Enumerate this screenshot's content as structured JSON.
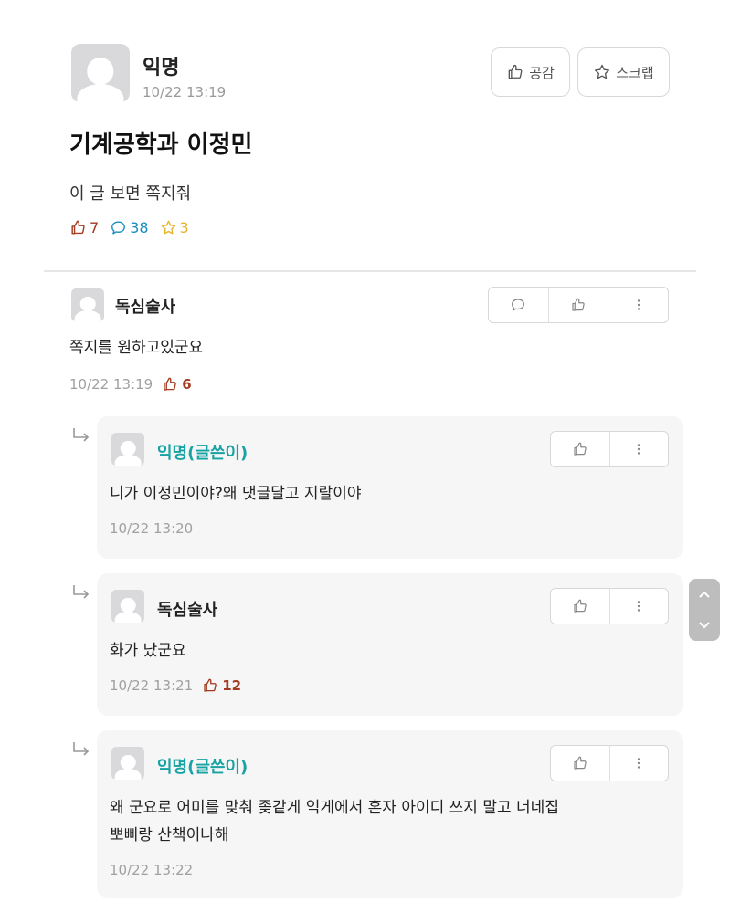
{
  "post": {
    "author": "익명",
    "time": "10/22 13:19",
    "like_label": "공감",
    "scrap_label": "스크랩",
    "title": "기계공학과 이정민",
    "body": "이 글 보면 쪽지줘",
    "stats": {
      "likes": "7",
      "comments": "38",
      "scraps": "3"
    }
  },
  "comments": [
    {
      "author": "독심술사",
      "text": "쪽지를 원하고있군요",
      "time": "10/22 13:19",
      "votes": "6"
    },
    {
      "author": "익명(글쓴이)",
      "text": "니가 이정민이야?왜 댓글달고 지랄이야",
      "time": "10/22 13:20",
      "votes": ""
    },
    {
      "author": "독심술사",
      "text": "화가 났군요",
      "time": "10/22 13:21",
      "votes": "12"
    },
    {
      "author": "익명(글쓴이)",
      "text_line1": "왜 군요로 어미를 맞춰 좆같게 익게에서 혼자 아이디 쓰지 말고 너네집",
      "text_line2": "뽀삐랑 산책이나해",
      "time": "10/22 13:22",
      "votes": ""
    }
  ],
  "icons": {
    "like": "thumbs-up-icon",
    "scrap": "star-icon",
    "comment": "speech-bubble-icon",
    "more": "vertical-dots-icon",
    "reply": "reply-arrow-icon",
    "scroll_up": "chevron-up-icon",
    "scroll_down": "chevron-down-icon"
  },
  "colors": {
    "op_name": "#17a3a3",
    "likes": "#a23b1f",
    "comments": "#1a8fbf",
    "scraps": "#e5b62d"
  }
}
